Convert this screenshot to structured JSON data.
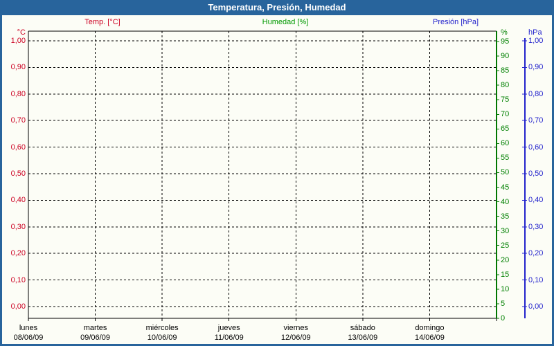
{
  "window_title": "Temperatura, Presión, Humedad",
  "legend": {
    "temp": {
      "label": "Temp. [°C]",
      "color": "#cc0022"
    },
    "humidity": {
      "label": "Humedad [%]",
      "color": "#009900"
    },
    "pressure": {
      "label": "Presión [hPa]",
      "color": "#2222cc"
    }
  },
  "chart_data": {
    "type": "line",
    "title": "Temperatura, Presión, Humedad",
    "series": [],
    "x_axis": {
      "days": [
        {
          "name": "lunes",
          "date": "08/06/09"
        },
        {
          "name": "martes",
          "date": "09/06/09"
        },
        {
          "name": "miércoles",
          "date": "10/06/09"
        },
        {
          "name": "jueves",
          "date": "11/06/09"
        },
        {
          "name": "viernes",
          "date": "12/06/09"
        },
        {
          "name": "sábado",
          "date": "13/06/09"
        },
        {
          "name": "domingo",
          "date": "14/06/09"
        }
      ]
    },
    "y_axis_temp": {
      "unit": "°C",
      "side": "left",
      "color": "#cc0022",
      "range": [
        0.0,
        1.0
      ],
      "ticks": [
        "1,00",
        "0,90",
        "0,80",
        "0,70",
        "0,60",
        "0,50",
        "0,40",
        "0,30",
        "0,20",
        "0,10",
        "0,00"
      ]
    },
    "y_axis_humidity": {
      "unit": "%",
      "side": "right",
      "color": "#008000",
      "range": [
        0,
        95
      ],
      "ticks": [
        95,
        90,
        85,
        80,
        75,
        70,
        65,
        60,
        55,
        50,
        45,
        40,
        35,
        30,
        25,
        20,
        15,
        10,
        5,
        0
      ]
    },
    "y_axis_pressure": {
      "unit": "hPa",
      "side": "right-outer",
      "color": "#2222cc",
      "range": [
        0.0,
        1.0
      ],
      "ticks": [
        "1,00",
        "0,90",
        "0,80",
        "0,70",
        "0,60",
        "0,50",
        "0,40",
        "0,30",
        "0,20",
        "0,10",
        "0,00"
      ]
    },
    "grid": {
      "horizontal_dashed": true,
      "vertical_dashed": true
    }
  },
  "colors": {
    "frame": "#28649c",
    "titlebar_bg": "#28649c",
    "titlebar_text": "#ffffff",
    "background": "#fcfdf6",
    "plot_border": "#000000",
    "gridline": "#000000",
    "humidity_axis_line": "#007700",
    "pressure_axis_line": "#2222cc",
    "x_label_text": "#000000"
  }
}
